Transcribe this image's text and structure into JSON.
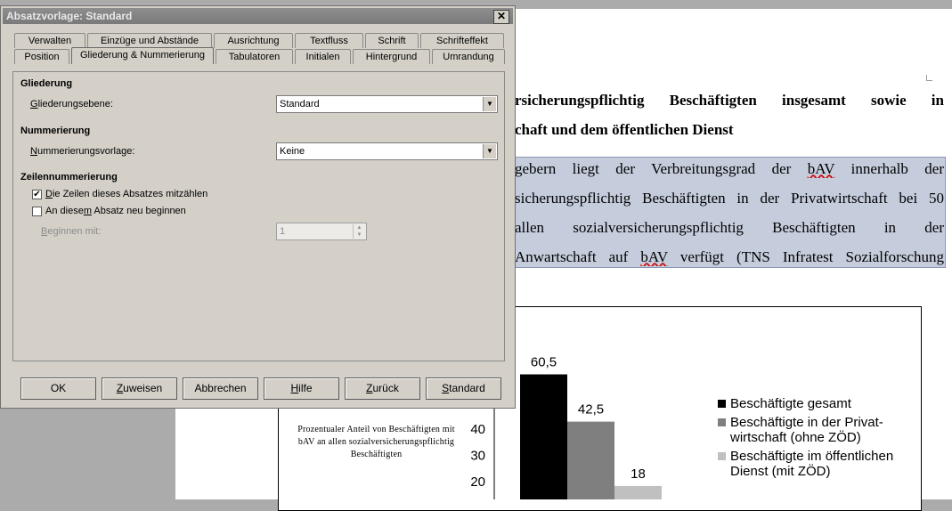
{
  "dialog": {
    "title": "Absatzvorlage: Standard",
    "close_glyph": "✕",
    "tabs_row1": [
      "Verwalten",
      "Einzüge und Abstände",
      "Ausrichtung",
      "Textfluss",
      "Schrift",
      "Schrifteffekt"
    ],
    "tabs_row2": [
      "Position",
      "Gliederung & Nummerierung",
      "Tabulatoren",
      "Initialen",
      "Hintergrund",
      "Umrandung"
    ],
    "active_tab": "Gliederung & Nummerierung",
    "gliederung": {
      "heading": "Gliederung",
      "level_label": "Gliederungsebene:",
      "level_value": "Standard"
    },
    "nummerierung": {
      "heading": "Nummerierung",
      "style_label": "Nummerierungsvorlage:",
      "style_value": "Keine"
    },
    "zeilennummerierung": {
      "heading": "Zeilennummerierung",
      "count_lines_label": "Die Zeilen dieses Absatzes mitzählen",
      "count_lines_checked": true,
      "restart_label": "An diesem Absatz neu beginnen",
      "restart_checked": false,
      "start_label": "Beginnen mit:",
      "start_value": "1"
    },
    "buttons": {
      "ok": "OK",
      "assign": "Zuweisen",
      "cancel": "Abbrechen",
      "help": "Hilfe",
      "back": "Zurück",
      "standard": "Standard"
    }
  },
  "document": {
    "heading_line1": "rsicherungspflichtig Beschäftigten insgesamt sowie in",
    "heading_line2": "chaft und dem öffentlichen Dienst",
    "para_line1": "gebern liegt der Verbreitungsgrad der bAV innerhalb der",
    "para_line2": "sicherungspflichtig Beschäftigten in der Privatwirtschaft bei 50",
    "para_line3": " allen sozialversicherungspflichtig Beschäftigten in der",
    "para_line4": "Anwartschaft auf bAV verfügt (TNS Infratest Sozialforschung"
  },
  "chart_data": {
    "type": "bar",
    "ylabel": "Prozentualer Anteil von Beschäftigten mit bAV an allen sozialversicherungspflichtig Beschäftigten",
    "yticks_visible": [
      40,
      30,
      20
    ],
    "series": [
      {
        "name": "Beschäftigte gesamt",
        "value": 60.5,
        "label": "60,5",
        "color": "#000000"
      },
      {
        "name": "Beschäftigte in der Privat-wirtschaft (ohne ZÖD)",
        "value": 42.5,
        "label": "42,5",
        "color": "#7f7f7f"
      },
      {
        "name": "Beschäftigte im öffentlichen Dienst (mit ZÖD)",
        "value": 18,
        "label": "18",
        "color": "#c0c0c0"
      }
    ],
    "legend_position": "right"
  }
}
